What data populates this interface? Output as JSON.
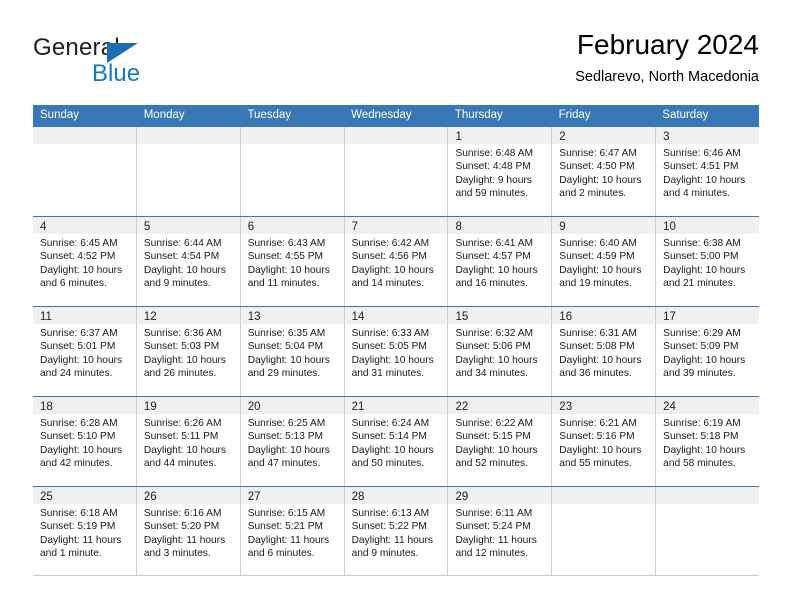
{
  "brand": {
    "name_top": "General",
    "name_bottom": "Blue",
    "accent_color": "#1479bf",
    "triangle_color": "#1d6db5"
  },
  "header": {
    "month_title": "February 2024",
    "location": "Sedlarevo, North Macedonia"
  },
  "theme": {
    "header_bar_color": "#3878b6",
    "day_band_color": "#f0f0f0",
    "grid_line_color": "#cfcfcf"
  },
  "weekdays": [
    "Sunday",
    "Monday",
    "Tuesday",
    "Wednesday",
    "Thursday",
    "Friday",
    "Saturday"
  ],
  "weeks": [
    [
      {
        "day": "",
        "sunrise": "",
        "sunset": "",
        "daylight_1": "",
        "daylight_2": ""
      },
      {
        "day": "",
        "sunrise": "",
        "sunset": "",
        "daylight_1": "",
        "daylight_2": ""
      },
      {
        "day": "",
        "sunrise": "",
        "sunset": "",
        "daylight_1": "",
        "daylight_2": ""
      },
      {
        "day": "",
        "sunrise": "",
        "sunset": "",
        "daylight_1": "",
        "daylight_2": ""
      },
      {
        "day": "1",
        "sunrise": "Sunrise: 6:48 AM",
        "sunset": "Sunset: 4:48 PM",
        "daylight_1": "Daylight: 9 hours",
        "daylight_2": "and 59 minutes."
      },
      {
        "day": "2",
        "sunrise": "Sunrise: 6:47 AM",
        "sunset": "Sunset: 4:50 PM",
        "daylight_1": "Daylight: 10 hours",
        "daylight_2": "and 2 minutes."
      },
      {
        "day": "3",
        "sunrise": "Sunrise: 6:46 AM",
        "sunset": "Sunset: 4:51 PM",
        "daylight_1": "Daylight: 10 hours",
        "daylight_2": "and 4 minutes."
      }
    ],
    [
      {
        "day": "4",
        "sunrise": "Sunrise: 6:45 AM",
        "sunset": "Sunset: 4:52 PM",
        "daylight_1": "Daylight: 10 hours",
        "daylight_2": "and 6 minutes."
      },
      {
        "day": "5",
        "sunrise": "Sunrise: 6:44 AM",
        "sunset": "Sunset: 4:54 PM",
        "daylight_1": "Daylight: 10 hours",
        "daylight_2": "and 9 minutes."
      },
      {
        "day": "6",
        "sunrise": "Sunrise: 6:43 AM",
        "sunset": "Sunset: 4:55 PM",
        "daylight_1": "Daylight: 10 hours",
        "daylight_2": "and 11 minutes."
      },
      {
        "day": "7",
        "sunrise": "Sunrise: 6:42 AM",
        "sunset": "Sunset: 4:56 PM",
        "daylight_1": "Daylight: 10 hours",
        "daylight_2": "and 14 minutes."
      },
      {
        "day": "8",
        "sunrise": "Sunrise: 6:41 AM",
        "sunset": "Sunset: 4:57 PM",
        "daylight_1": "Daylight: 10 hours",
        "daylight_2": "and 16 minutes."
      },
      {
        "day": "9",
        "sunrise": "Sunrise: 6:40 AM",
        "sunset": "Sunset: 4:59 PM",
        "daylight_1": "Daylight: 10 hours",
        "daylight_2": "and 19 minutes."
      },
      {
        "day": "10",
        "sunrise": "Sunrise: 6:38 AM",
        "sunset": "Sunset: 5:00 PM",
        "daylight_1": "Daylight: 10 hours",
        "daylight_2": "and 21 minutes."
      }
    ],
    [
      {
        "day": "11",
        "sunrise": "Sunrise: 6:37 AM",
        "sunset": "Sunset: 5:01 PM",
        "daylight_1": "Daylight: 10 hours",
        "daylight_2": "and 24 minutes."
      },
      {
        "day": "12",
        "sunrise": "Sunrise: 6:36 AM",
        "sunset": "Sunset: 5:03 PM",
        "daylight_1": "Daylight: 10 hours",
        "daylight_2": "and 26 minutes."
      },
      {
        "day": "13",
        "sunrise": "Sunrise: 6:35 AM",
        "sunset": "Sunset: 5:04 PM",
        "daylight_1": "Daylight: 10 hours",
        "daylight_2": "and 29 minutes."
      },
      {
        "day": "14",
        "sunrise": "Sunrise: 6:33 AM",
        "sunset": "Sunset: 5:05 PM",
        "daylight_1": "Daylight: 10 hours",
        "daylight_2": "and 31 minutes."
      },
      {
        "day": "15",
        "sunrise": "Sunrise: 6:32 AM",
        "sunset": "Sunset: 5:06 PM",
        "daylight_1": "Daylight: 10 hours",
        "daylight_2": "and 34 minutes."
      },
      {
        "day": "16",
        "sunrise": "Sunrise: 6:31 AM",
        "sunset": "Sunset: 5:08 PM",
        "daylight_1": "Daylight: 10 hours",
        "daylight_2": "and 36 minutes."
      },
      {
        "day": "17",
        "sunrise": "Sunrise: 6:29 AM",
        "sunset": "Sunset: 5:09 PM",
        "daylight_1": "Daylight: 10 hours",
        "daylight_2": "and 39 minutes."
      }
    ],
    [
      {
        "day": "18",
        "sunrise": "Sunrise: 6:28 AM",
        "sunset": "Sunset: 5:10 PM",
        "daylight_1": "Daylight: 10 hours",
        "daylight_2": "and 42 minutes."
      },
      {
        "day": "19",
        "sunrise": "Sunrise: 6:26 AM",
        "sunset": "Sunset: 5:11 PM",
        "daylight_1": "Daylight: 10 hours",
        "daylight_2": "and 44 minutes."
      },
      {
        "day": "20",
        "sunrise": "Sunrise: 6:25 AM",
        "sunset": "Sunset: 5:13 PM",
        "daylight_1": "Daylight: 10 hours",
        "daylight_2": "and 47 minutes."
      },
      {
        "day": "21",
        "sunrise": "Sunrise: 6:24 AM",
        "sunset": "Sunset: 5:14 PM",
        "daylight_1": "Daylight: 10 hours",
        "daylight_2": "and 50 minutes."
      },
      {
        "day": "22",
        "sunrise": "Sunrise: 6:22 AM",
        "sunset": "Sunset: 5:15 PM",
        "daylight_1": "Daylight: 10 hours",
        "daylight_2": "and 52 minutes."
      },
      {
        "day": "23",
        "sunrise": "Sunrise: 6:21 AM",
        "sunset": "Sunset: 5:16 PM",
        "daylight_1": "Daylight: 10 hours",
        "daylight_2": "and 55 minutes."
      },
      {
        "day": "24",
        "sunrise": "Sunrise: 6:19 AM",
        "sunset": "Sunset: 5:18 PM",
        "daylight_1": "Daylight: 10 hours",
        "daylight_2": "and 58 minutes."
      }
    ],
    [
      {
        "day": "25",
        "sunrise": "Sunrise: 6:18 AM",
        "sunset": "Sunset: 5:19 PM",
        "daylight_1": "Daylight: 11 hours",
        "daylight_2": "and 1 minute."
      },
      {
        "day": "26",
        "sunrise": "Sunrise: 6:16 AM",
        "sunset": "Sunset: 5:20 PM",
        "daylight_1": "Daylight: 11 hours",
        "daylight_2": "and 3 minutes."
      },
      {
        "day": "27",
        "sunrise": "Sunrise: 6:15 AM",
        "sunset": "Sunset: 5:21 PM",
        "daylight_1": "Daylight: 11 hours",
        "daylight_2": "and 6 minutes."
      },
      {
        "day": "28",
        "sunrise": "Sunrise: 6:13 AM",
        "sunset": "Sunset: 5:22 PM",
        "daylight_1": "Daylight: 11 hours",
        "daylight_2": "and 9 minutes."
      },
      {
        "day": "29",
        "sunrise": "Sunrise: 6:11 AM",
        "sunset": "Sunset: 5:24 PM",
        "daylight_1": "Daylight: 11 hours",
        "daylight_2": "and 12 minutes."
      },
      {
        "day": "",
        "sunrise": "",
        "sunset": "",
        "daylight_1": "",
        "daylight_2": ""
      },
      {
        "day": "",
        "sunrise": "",
        "sunset": "",
        "daylight_1": "",
        "daylight_2": ""
      }
    ]
  ]
}
